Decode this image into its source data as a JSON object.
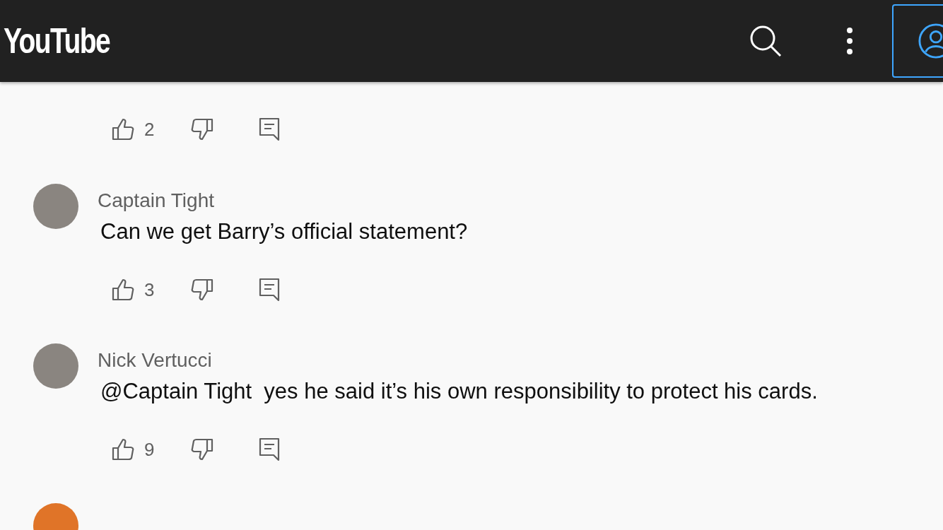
{
  "header": {
    "logo": "YouTube"
  },
  "comments": [
    {
      "likes": "2"
    },
    {
      "author": "Captain Tight",
      "text": "Can we get Barry’s official statement?",
      "likes": "3",
      "avatar": {
        "kind": "photo"
      }
    },
    {
      "author": "Nick Vertucci",
      "text": "@Captain Tight  yes he said it’s his own responsibility to protect his cards.",
      "likes": "9",
      "avatar": {
        "kind": "photo"
      }
    },
    {
      "avatar": {
        "kind": "plain",
        "color": "#e07428"
      }
    }
  ]
}
